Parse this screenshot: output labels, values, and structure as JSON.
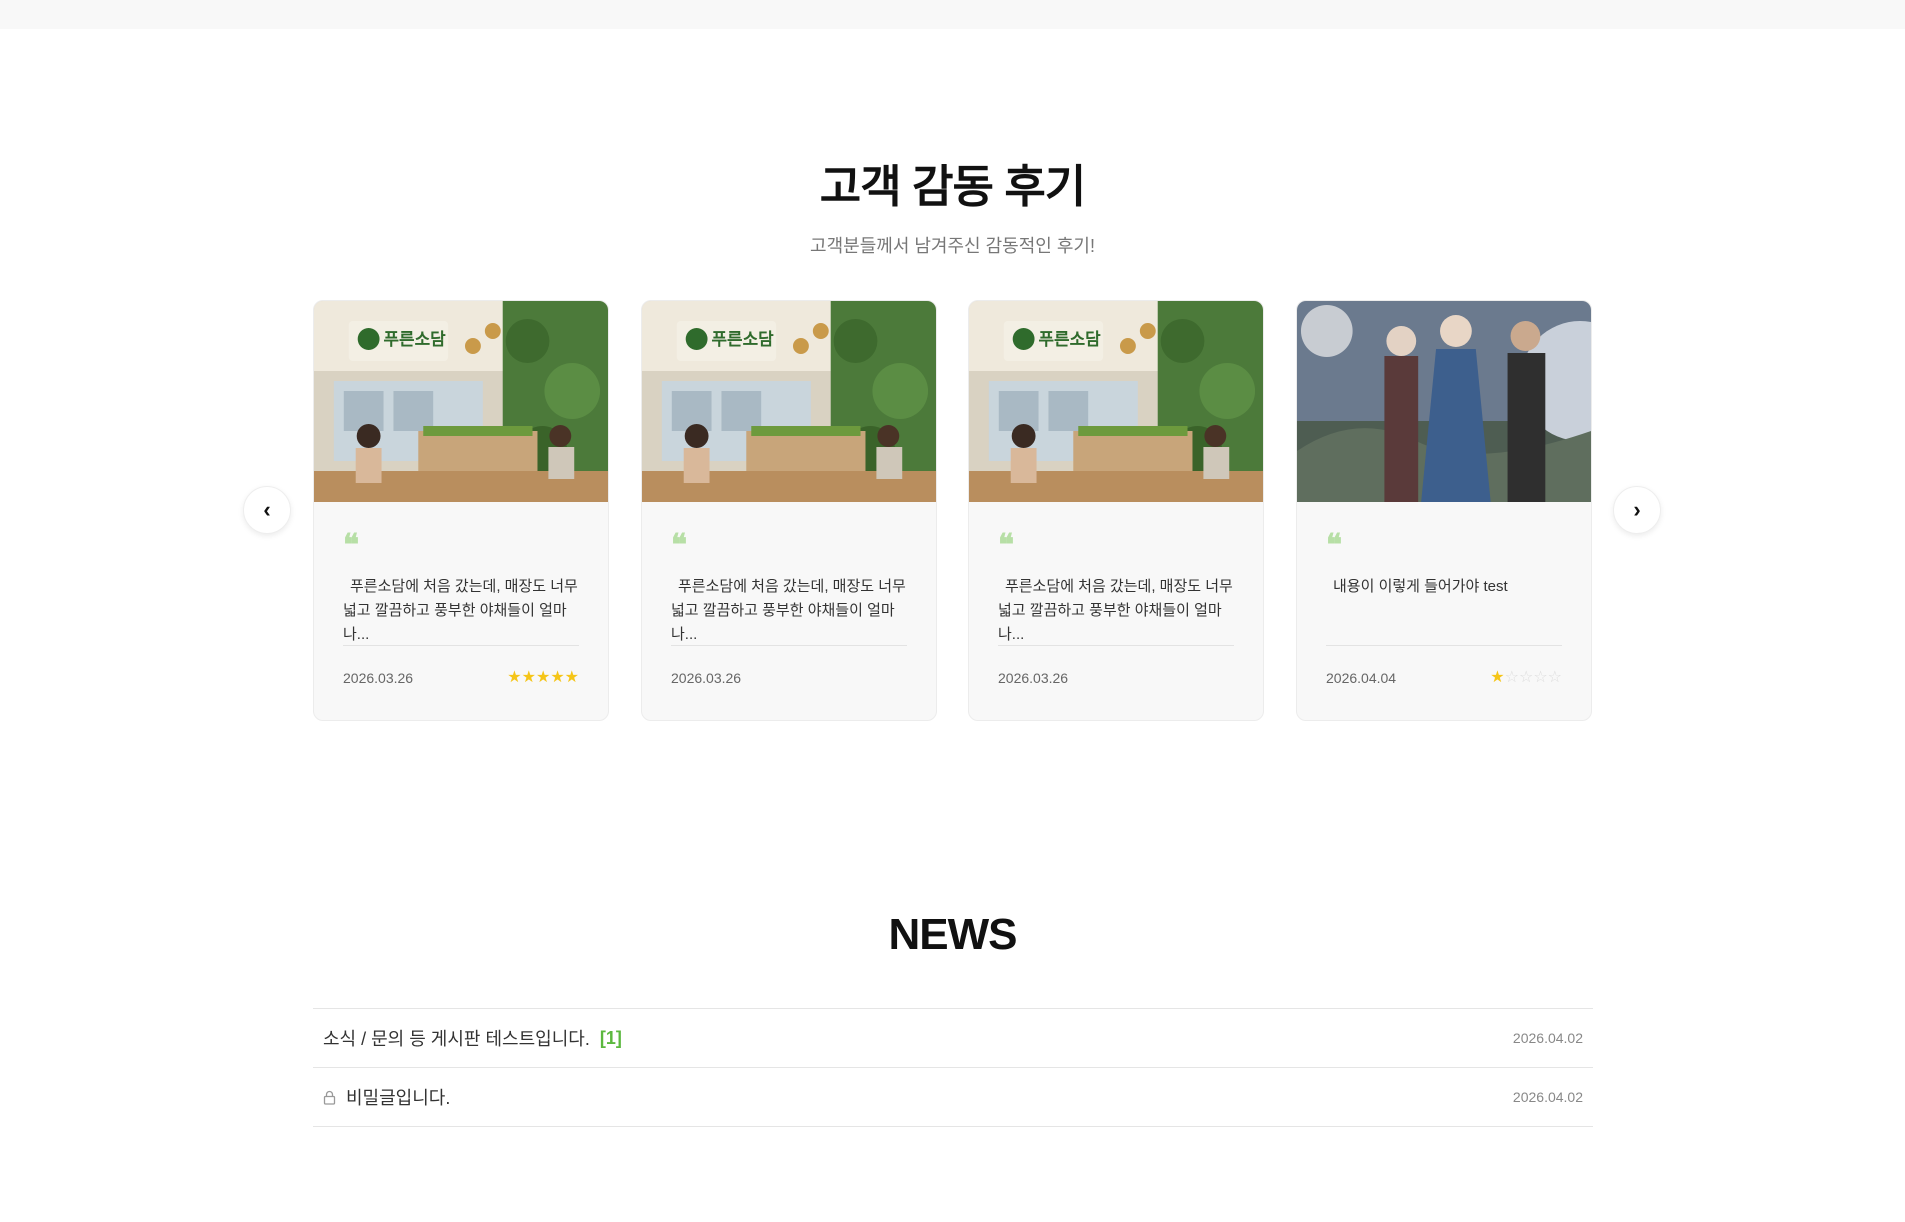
{
  "review_section": {
    "title": "고객 감동 후기",
    "subtitle": "고객분들께서 남겨주신 감동적인 후기!"
  },
  "reviews": [
    {
      "image": "restaurant-interior",
      "sign_text": "푸른소담",
      "text": "푸른소담에 처음 갔는데, 매장도 너무 넓고 깔끔하고 풍부한 야채들이 얼마나...",
      "date": "2026.03.26",
      "rating": 5
    },
    {
      "image": "restaurant-interior",
      "sign_text": "푸른소담",
      "text": "푸른소담에 처음 갔는데, 매장도 너무 넓고 깔끔하고 풍부한 야채들이 얼마나...",
      "date": "2026.03.26",
      "rating": 0
    },
    {
      "image": "restaurant-interior",
      "sign_text": "푸른소담",
      "text": "푸른소담에 처음 갔는데, 매장도 너무 넓고 깔끔하고 풍부한 야채들이 얼마나...",
      "date": "2026.03.26",
      "rating": 0
    },
    {
      "image": "fantasy-characters",
      "text": "내용이 이렇게 들어가야 test",
      "date": "2026.04.04",
      "rating": 1
    }
  ],
  "carousel": {
    "prev_icon": "‹",
    "next_icon": "›"
  },
  "quote_mark": "❝",
  "news_section": {
    "title": "NEWS",
    "items": [
      {
        "title": "소식 / 문의 등 게시판 테스트입니다.",
        "count": "[1]",
        "date": "2026.04.02",
        "locked": false
      },
      {
        "title": "비밀글입니다.",
        "count": "",
        "date": "2026.04.02",
        "locked": true
      }
    ]
  },
  "colors": {
    "accent_green": "#5cb83f",
    "star_gold": "#f5c518",
    "quote_green": "#b7dfa6"
  }
}
